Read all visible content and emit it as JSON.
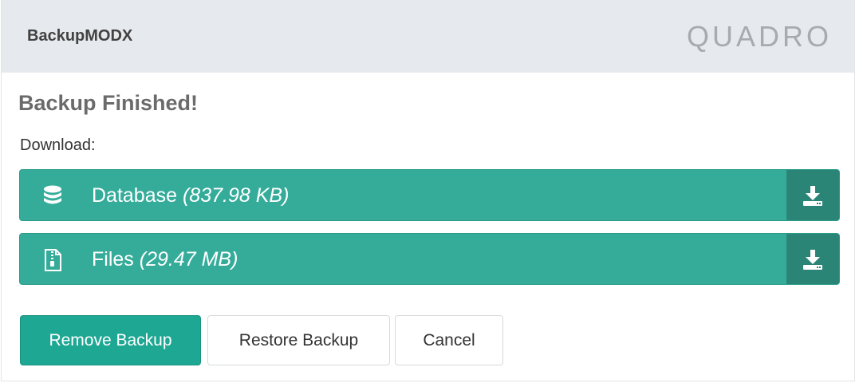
{
  "header": {
    "app_title": "BackupMODX",
    "brand": "QUADRO"
  },
  "main": {
    "heading": "Backup Finished!",
    "download_label": "Download:",
    "downloads": [
      {
        "name": "Database",
        "size": "(837.98 KB)",
        "icon": "database-icon",
        "action_icon": "download-icon"
      },
      {
        "name": "Files",
        "size": "(29.47 MB)",
        "icon": "zip-file-icon",
        "action_icon": "download-icon"
      }
    ]
  },
  "actions": {
    "remove_label": "Remove Backup",
    "restore_label": "Restore Backup",
    "cancel_label": "Cancel"
  },
  "colors": {
    "header_bg": "#e6e9ed",
    "row_bg": "#35ac9a",
    "row_action_bg": "#2b8577",
    "primary_button": "#1ea893"
  }
}
